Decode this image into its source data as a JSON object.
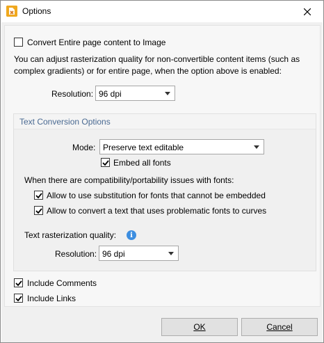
{
  "window": {
    "title": "Options",
    "icon": "pdf-xchange-icon",
    "close": "close-icon"
  },
  "convert_page": {
    "label": "Convert Entire page content to Image",
    "checked": false
  },
  "description": "You can adjust rasterization quality for non-convertible content items (such as complex gradients) or for entire page, when the option above is enabled:",
  "resolution_top": {
    "label": "Resolution:",
    "value": "96 dpi"
  },
  "text_conversion": {
    "title": "Text Conversion Options",
    "mode_label": "Mode:",
    "mode_value": "Preserve text editable",
    "embed_fonts_label": "Embed all fonts",
    "embed_fonts_checked": true,
    "issues_text": "When there are compatibility/portability issues with fonts:",
    "substitution_label": "Allow to use substitution for fonts that cannot be embedded",
    "substitution_checked": true,
    "curves_label": "Allow to convert a text that uses problematic fonts to curves",
    "curves_checked": true,
    "raster_quality_label": "Text rasterization quality:",
    "resolution_label": "Resolution:",
    "resolution_value": "96 dpi"
  },
  "include_comments": {
    "label": "Include Comments",
    "checked": true
  },
  "include_links": {
    "label": "Include Links",
    "checked": true
  },
  "buttons": {
    "ok": "OK",
    "cancel": "Cancel"
  },
  "colors": {
    "accent_icon": "#f0a81e",
    "group_title": "#4a6a92",
    "info": "#3d8ee0"
  }
}
